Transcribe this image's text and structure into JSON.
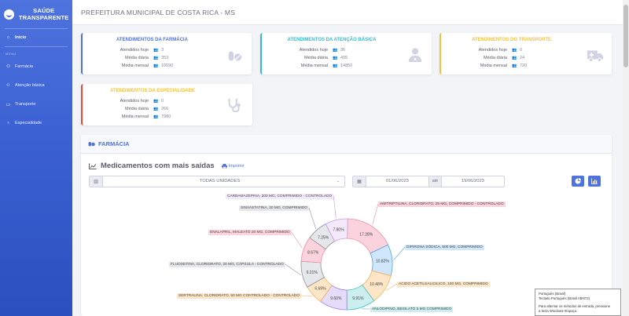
{
  "sidebar": {
    "brand_line1": "SAÚDE",
    "brand_line2": "TRANSPARENTE",
    "home_label": "Início",
    "menu_heading": "MENU",
    "items": [
      {
        "label": "Farmácia",
        "icon": "pills-icon"
      },
      {
        "label": "Atenção básica",
        "icon": "user-md-icon"
      },
      {
        "label": "Transporte",
        "icon": "truck-icon"
      },
      {
        "label": "Especialidade",
        "icon": "stethoscope-icon"
      }
    ]
  },
  "topbar": {
    "title": "PREFEITURA MUNICIPAL DE COSTA RICA - MS"
  },
  "cards": [
    {
      "title": "ATENDIMENTOS DA FARMÁCIA",
      "color": "#4e73df",
      "icon": "pills-icon",
      "rows": [
        {
          "label": "Atendidos hoje",
          "value": "3"
        },
        {
          "label": "Média diária",
          "value": "353"
        },
        {
          "label": "Média mensal",
          "value": "10590"
        }
      ]
    },
    {
      "title": "ATENDIMENTOS DA ATENÇÃO BÁSICA",
      "color": "#36b9cc",
      "icon": "user-md-icon",
      "rows": [
        {
          "label": "Atendidos hoje",
          "value": "36"
        },
        {
          "label": "Média diária",
          "value": "495"
        },
        {
          "label": "Média mensal",
          "value": "14850"
        }
      ]
    },
    {
      "title": "ATENDIMENTOS DO TRANSPORTE",
      "color": "#f6c23e",
      "icon": "ambulance-icon",
      "rows": [
        {
          "label": "Atendidos hoje",
          "value": "0"
        },
        {
          "label": "Média diária",
          "value": "24"
        },
        {
          "label": "Média mensal",
          "value": "720"
        }
      ]
    },
    {
      "title": "ATENDIMENTOS DA ESPECIALIDADE",
      "color": "#e74a3b",
      "icon": "stethoscope-icon",
      "rows": [
        {
          "label": "Atendidos hoje",
          "value": "0"
        },
        {
          "label": "Média diária",
          "value": "266"
        },
        {
          "label": "Média mensal",
          "value": "7980"
        }
      ]
    }
  ],
  "panel": {
    "header": "FARMÁCIA",
    "section_title": "Medicamentos com mais saídas",
    "print_label": "Imprimir",
    "unit_select": "TODAS UNIDADES",
    "date_from": "01/06/2023",
    "date_to_label": "até",
    "date_to": "19/06/2023"
  },
  "chart_data": {
    "type": "pie",
    "donut": true,
    "slices": [
      {
        "label": "AMITRIPTILINA, CLORIDRATO, 25 MG, COMPRIMIDO - CONTROLADO",
        "value": 17.28,
        "color": "#fbd3dc"
      },
      {
        "label": "DIPIRONA SÓDICA, 500 MG, COMPRIMIDO",
        "value": 10.82,
        "color": "#cfe6fb"
      },
      {
        "label": "ACIDO ACETILSALICILICO, 100 MG, COMPRIMIDO",
        "value": 10.48,
        "color": "#fde6c7"
      },
      {
        "label": "ANLODIPINO, BESILATO 5 MG COMPRIMIDO",
        "value": 9.91,
        "color": "#cdeeee"
      },
      {
        "label": "",
        "value": 9.6,
        "color": "#e5dcfa"
      },
      {
        "label": "SERTRALINA, CLORIDRATO, 50 MG CONTROLADO - CONTROLADO",
        "value": 6.69,
        "color": "#fde6c7"
      },
      {
        "label": "",
        "value": 0,
        "color": "#fbd3dc"
      },
      {
        "label": "FLUOXETINA, CLORIDRATO, 20 MG, CÁPSULA - CONTROLADO",
        "value": 9.21,
        "color": "#e6e7ea"
      },
      {
        "label": "ENALAPRIL, MALEATO 20 MG, COMPRIMIDO",
        "value": 8.67,
        "color": "#fbd3dc"
      },
      {
        "label": "SINVASTATINA, 20 MG, COMPRIMIDO",
        "value": 7.25,
        "color": "#e6e7ea"
      },
      {
        "label": "CARBAMAZEPINA, 200 MG, COMPRIMIDO - CONTROLADO",
        "value": 7.8,
        "color": "#f4e9fb"
      }
    ]
  },
  "language_popup": {
    "line1": "Português (Brasil)",
    "line2": "Teclado Português (Brasil ABNT2)",
    "line3": "Para alternar os métodos de entrada, pressione",
    "line4": "a tecla Windows+Espaço."
  }
}
